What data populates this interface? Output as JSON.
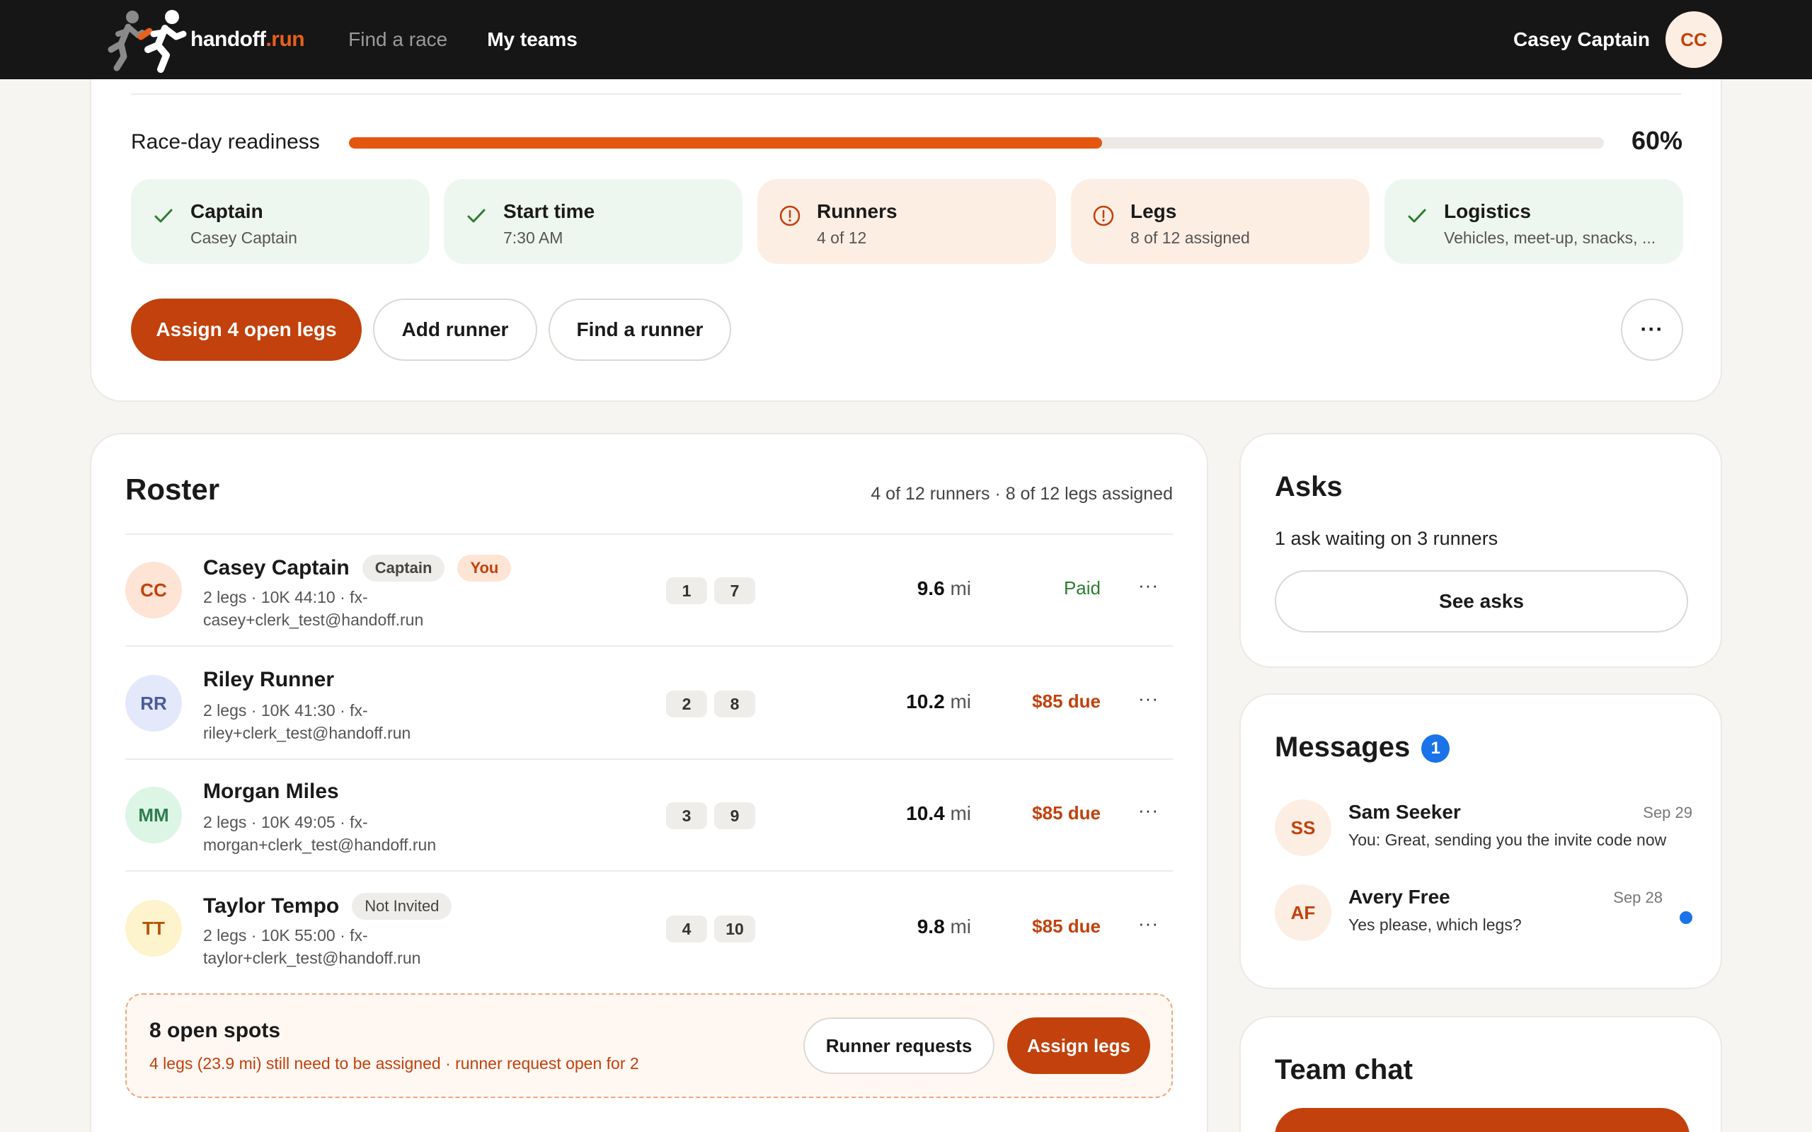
{
  "nav": {
    "brand_main": "handoff",
    "brand_accent": ".run",
    "links": [
      {
        "label": "Find a race"
      },
      {
        "label": "My teams"
      }
    ],
    "user_name": "Casey Captain",
    "user_initials": "CC"
  },
  "readiness": {
    "label": "Race-day readiness",
    "percent_label": "60%",
    "progress": 0.6,
    "steps": [
      {
        "title": "Captain",
        "sub": "Casey Captain",
        "status": "ok"
      },
      {
        "title": "Start time",
        "sub": "7:30 AM",
        "status": "ok"
      },
      {
        "title": "Runners",
        "sub": "4 of 12",
        "status": "warn"
      },
      {
        "title": "Legs",
        "sub": "8 of 12 assigned",
        "status": "warn"
      },
      {
        "title": "Logistics",
        "sub": "Vehicles, meet-up, snacks, ...",
        "status": "ok"
      }
    ],
    "actions": {
      "assign": "Assign 4 open legs",
      "add_runner": "Add runner",
      "find_runner": "Find a runner",
      "more": "···"
    }
  },
  "roster": {
    "title": "Roster",
    "summary": "4 of 12 runners · 8 of 12 legs assigned",
    "rows": [
      {
        "initials": "CC",
        "name": "Casey Captain",
        "tags": [
          "Captain",
          "You"
        ],
        "meta1": "2 legs · 10K 44:10 · fx-",
        "meta2": "casey+clerk_test@handoff.run",
        "legs": [
          "1",
          "7"
        ],
        "distance": "9.6",
        "unit": "mi",
        "payment": "Paid",
        "avatar_bg": "#fde4d4",
        "avatar_fg": "#c2410c"
      },
      {
        "initials": "RR",
        "name": "Riley Runner",
        "tags": [],
        "meta1": "2 legs · 10K 41:30 · fx-",
        "meta2": "riley+clerk_test@handoff.run",
        "legs": [
          "2",
          "8"
        ],
        "distance": "10.2",
        "unit": "mi",
        "payment": "$85 due",
        "avatar_bg": "#e3e8fb",
        "avatar_fg": "#4a5a9a"
      },
      {
        "initials": "MM",
        "name": "Morgan Miles",
        "tags": [],
        "meta1": "2 legs · 10K 49:05 · fx-",
        "meta2": "morgan+clerk_test@handoff.run",
        "legs": [
          "3",
          "9"
        ],
        "distance": "10.4",
        "unit": "mi",
        "payment": "$85 due",
        "avatar_bg": "#dcf5e4",
        "avatar_fg": "#2e7d4f"
      },
      {
        "initials": "TT",
        "name": "Taylor Tempo",
        "tags": [
          "Not Invited"
        ],
        "meta1": "2 legs · 10K 55:00 · fx-",
        "meta2": "taylor+clerk_test@handoff.run",
        "legs": [
          "4",
          "10"
        ],
        "distance": "9.8",
        "unit": "mi",
        "payment": "$85 due",
        "avatar_bg": "#fdf3cc",
        "avatar_fg": "#b45309"
      }
    ],
    "row_more": "···",
    "open_spots": {
      "title": "8 open spots",
      "sub": "4 legs (23.9 mi) still need to be assigned · runner request open for 2",
      "requests_btn": "Runner requests",
      "assign_btn": "Assign legs"
    }
  },
  "asks": {
    "title": "Asks",
    "text": "1 ask waiting on 3 runners",
    "button": "See asks"
  },
  "messages": {
    "title": "Messages",
    "badge": "1",
    "items": [
      {
        "initials": "SS",
        "name": "Sam Seeker",
        "date": "Sep 29",
        "text": "You: Great, sending you the invite code now",
        "unread": false
      },
      {
        "initials": "AF",
        "name": "Avery Free",
        "date": "Sep 28",
        "text": "Yes please, which legs?",
        "unread": true
      }
    ]
  },
  "team_chat": {
    "title": "Team chat"
  },
  "colors": {
    "accent": "#c2410c",
    "progress": "#e2560f",
    "ok_bg": "#eef7ef",
    "warn_bg": "#fdeee4",
    "nav_bg": "#161616",
    "badge": "#1a73e8"
  }
}
